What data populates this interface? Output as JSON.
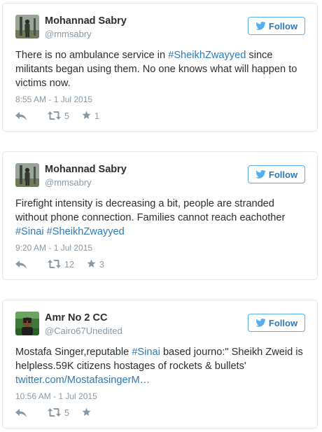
{
  "tweets": [
    {
      "name": "Mohannad Sabry",
      "handle": "@mmsabry",
      "follow_label": "Follow",
      "text_before": "There is no ambulance service in ",
      "hashtag1": "#SheikhZwayyed",
      "text_after": " since militants began using them. No one knows what will happen to victims now.",
      "date": "8:55 AM - 1 Jul 2015",
      "retweets": "5",
      "favorites": "1"
    },
    {
      "name": "Mohannad Sabry",
      "handle": "@mmsabry",
      "follow_label": "Follow",
      "text_before": "Firefight intensity is decreasing a bit, people are stranded without phone connection. Families cannot reach eachother ",
      "hashtag1": "#Sinai",
      "hashtag2": "#SheikhZwayyed",
      "date": "9:20 AM - 1 Jul 2015",
      "retweets": "12",
      "favorites": "3"
    },
    {
      "name": "Amr No 2 CC",
      "handle": "@Cairo67Unedited",
      "follow_label": "Follow",
      "text_before": "Mostafa Singer,reputable ",
      "hashtag1": "#Sinai",
      "text_after": " based journo:\" Sheikh Zweid is helpless.59K citizens hostages of rockets & bullets'",
      "link": "twitter.com/MostafasingerM…",
      "date": "10:56 AM - 1 Jul 2015",
      "retweets": "5",
      "favorites": ""
    }
  ],
  "colors": {
    "link": "#2b7bb9",
    "muted": "#8899a6",
    "border": "#e1e8ed",
    "follow_border": "#55acee"
  },
  "icons": [
    "bird-icon",
    "reply-icon",
    "retweet-icon",
    "star-icon"
  ]
}
